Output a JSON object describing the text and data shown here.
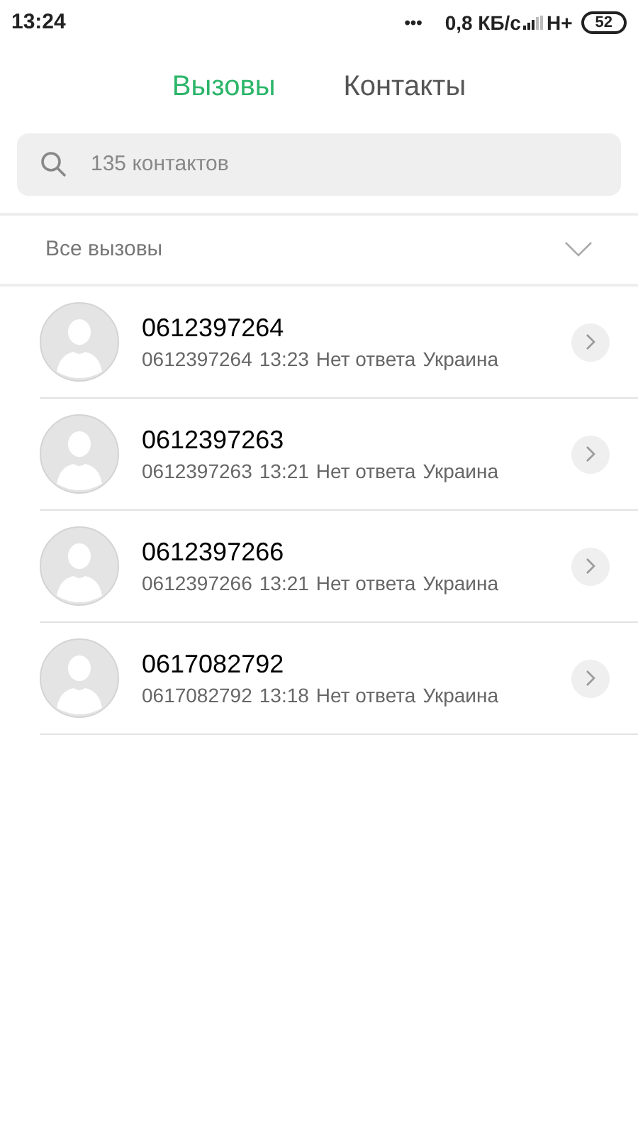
{
  "status_bar": {
    "time": "13:24",
    "dots": "•••",
    "speed": "0,8 КБ/с",
    "network": "H+",
    "battery": "52"
  },
  "tabs": [
    {
      "label": "Вызовы",
      "selected": true
    },
    {
      "label": "Контакты",
      "selected": false
    }
  ],
  "search": {
    "placeholder": "135 контактов"
  },
  "filter": {
    "label": "Все вызовы"
  },
  "calls": [
    {
      "name": "0612397264",
      "number": "0612397264",
      "time": "13:23",
      "status": "Нет ответа",
      "location": "Украина"
    },
    {
      "name": "0612397263",
      "number": "0612397263",
      "time": "13:21",
      "status": "Нет ответа",
      "location": "Украина"
    },
    {
      "name": "0612397266",
      "number": "0612397266",
      "time": "13:21",
      "status": "Нет ответа",
      "location": "Украина"
    },
    {
      "name": "0617082792",
      "number": "0617082792",
      "time": "13:18",
      "status": "Нет ответа",
      "location": "Украина"
    }
  ]
}
